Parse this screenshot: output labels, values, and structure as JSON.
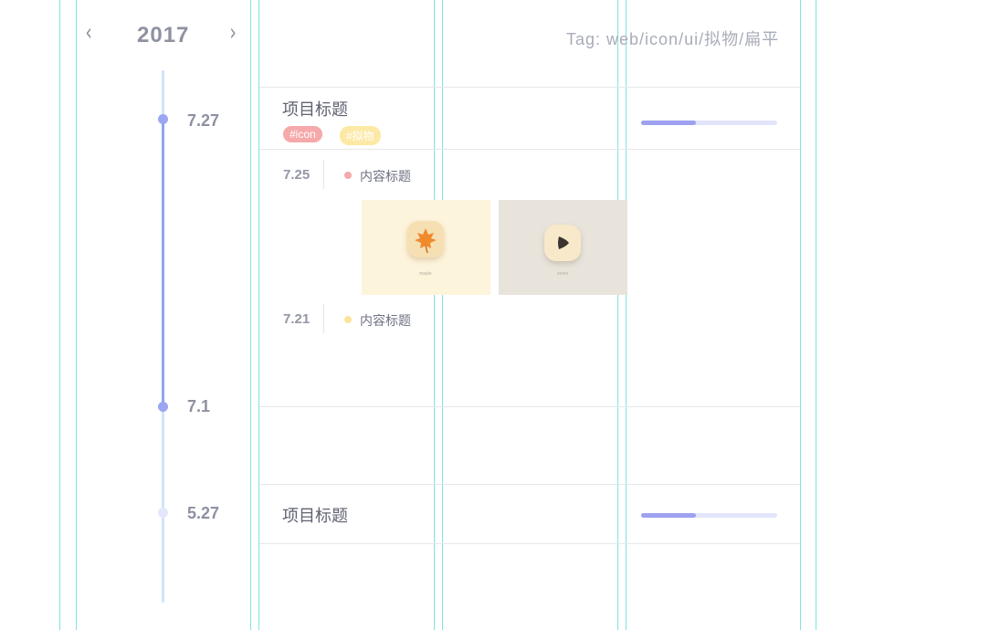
{
  "header": {
    "prev_label": "‹",
    "year": "2017",
    "next_label": "›",
    "tag_line": "Tag: web/icon/ui/拟物/扁平"
  },
  "timeline": {
    "dates": [
      "7.27",
      "7.1",
      "5.27"
    ]
  },
  "projects": [
    {
      "title": "项目标题",
      "tags": [
        "#icon",
        "#拟物"
      ],
      "progress": 0.4,
      "entries": [
        {
          "date": "7.25",
          "title": "内容标题",
          "dot_color": "#f2aaa8",
          "thumbnails": [
            {
              "icon": "maple-leaf-icon",
              "caption": "maple"
            },
            {
              "icon": "play-icon",
              "caption": "stone"
            }
          ]
        },
        {
          "date": "7.21",
          "title": "内容标题",
          "dot_color": "#fde39b"
        }
      ]
    },
    {
      "title": "项目标题",
      "progress": 0.4
    }
  ],
  "colors": {
    "accent": "#9ea1ef",
    "guide": "#7fe3e0",
    "tag_red": "#f6a9aa",
    "tag_yellow": "#fde9a6"
  }
}
